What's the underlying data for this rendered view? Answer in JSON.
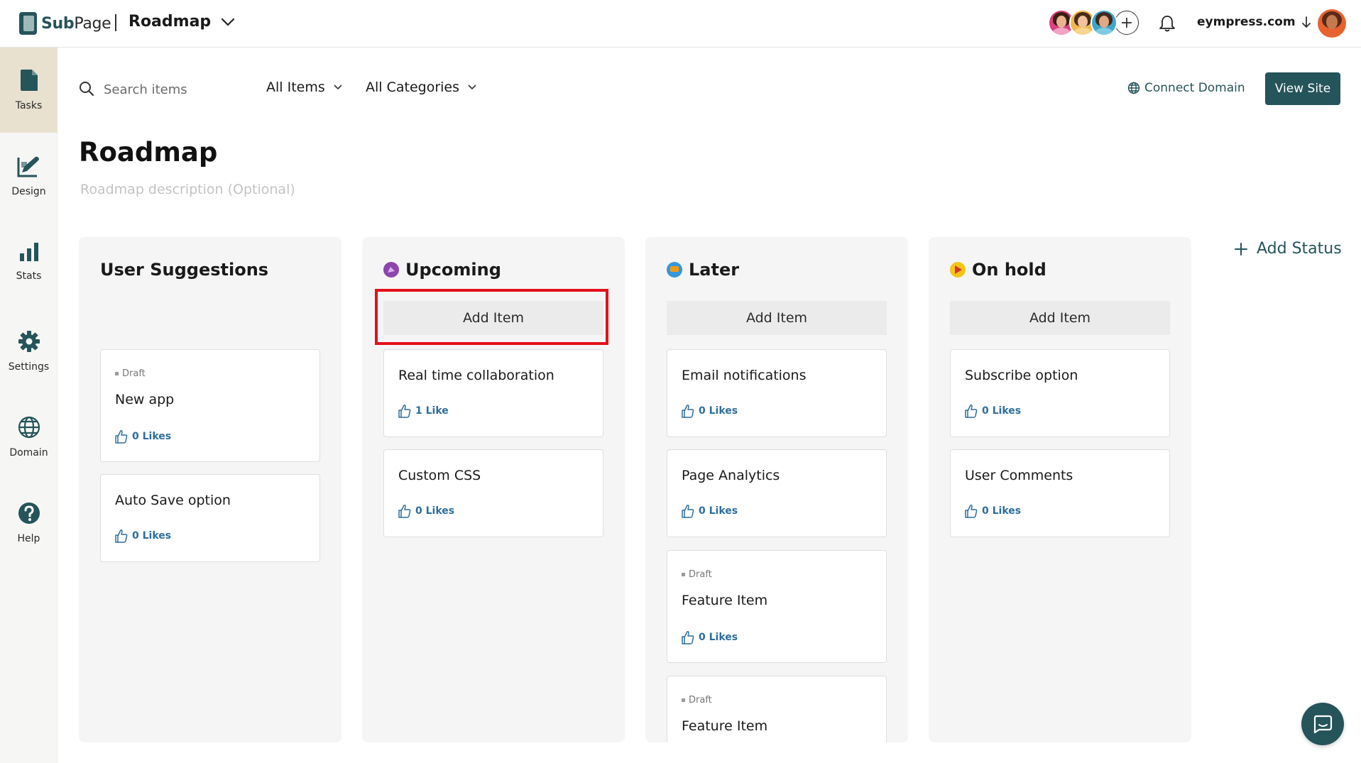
{
  "brand": {
    "name_prefix": "Sub",
    "name_suffix": "Page"
  },
  "header": {
    "page_switch_label": "Roadmap",
    "site_label": "eympress.com"
  },
  "sidebar": {
    "items": [
      {
        "label": "Tasks",
        "icon": "document-icon",
        "active": true
      },
      {
        "label": "Design",
        "icon": "design-icon"
      },
      {
        "label": "Stats",
        "icon": "bar-chart-icon"
      },
      {
        "label": "Settings",
        "icon": "gear-icon"
      },
      {
        "label": "Domain",
        "icon": "globe-icon"
      },
      {
        "label": "Help",
        "icon": "help-icon"
      }
    ]
  },
  "toolbar": {
    "search_placeholder": "Search items",
    "filter_items": "All Items",
    "filter_categories": "All Categories",
    "connect_domain": "Connect Domain",
    "view_site": "View Site"
  },
  "page": {
    "title": "Roadmap",
    "description_placeholder": "Roadmap description (Optional)"
  },
  "board": {
    "add_status": "Add Status",
    "add_item_label": "Add Item",
    "draft_label": "Draft",
    "columns": [
      {
        "title": "User Suggestions",
        "cards": [
          {
            "title": "New app",
            "likes": "0 Likes",
            "draft": true
          },
          {
            "title": "Auto Save option",
            "likes": "0 Likes"
          }
        ]
      },
      {
        "title": "Upcoming",
        "status_color": "#8e44ad",
        "cards": [
          {
            "title": "Real time collaboration",
            "likes": "1 Like"
          },
          {
            "title": "Custom CSS",
            "likes": "0 Likes"
          }
        ]
      },
      {
        "title": "Later",
        "status_color": "#3498db",
        "cards": [
          {
            "title": "Email notifications",
            "likes": "0 Likes"
          },
          {
            "title": "Page Analytics",
            "likes": "0 Likes"
          },
          {
            "title": "Feature Item",
            "likes": "0 Likes",
            "draft": true
          },
          {
            "title": "Feature Item",
            "draft": true
          }
        ]
      },
      {
        "title": "On hold",
        "status_color": "#f5c518",
        "cards": [
          {
            "title": "Subscribe option",
            "likes": "0 Likes"
          },
          {
            "title": "User Comments",
            "likes": "0 Likes"
          }
        ]
      }
    ]
  },
  "colors": {
    "brand": "#25545a",
    "like": "#2c6e9b",
    "highlight": "#e3101a"
  }
}
